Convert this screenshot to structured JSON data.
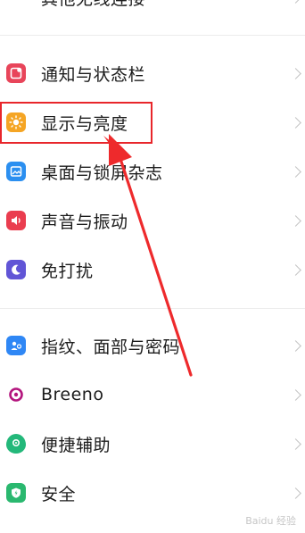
{
  "top_partial": {
    "label": "其他无线连接"
  },
  "group1": [
    {
      "label": "通知与状态栏",
      "icon": "notification-icon",
      "color": "#e8455a"
    },
    {
      "label": "显示与亮度",
      "icon": "sun-brightness-icon",
      "color": "#f5a524"
    },
    {
      "label": "桌面与锁屏杂志",
      "icon": "wallpaper-icon",
      "color": "#2b8ff0"
    },
    {
      "label": "声音与振动",
      "icon": "speaker-icon",
      "color": "#ea3d4f"
    },
    {
      "label": "免打扰",
      "icon": "moon-icon",
      "color": "#6155d6"
    }
  ],
  "group2": [
    {
      "label": "指纹、面部与密码",
      "icon": "biometric-icon",
      "color": "#2f87f5"
    },
    {
      "label": "Breeno",
      "icon": "breeno-icon",
      "color": "#b4167e"
    },
    {
      "label": "便捷辅助",
      "icon": "assist-icon",
      "color": "#23b87a"
    },
    {
      "label": "安全",
      "icon": "shield-icon",
      "color": "#2ab86f"
    }
  ],
  "watermark": "Baidu 经验",
  "annotation": {
    "highlight_color": "#e8262b",
    "arrow_color": "#ee2a2c"
  }
}
